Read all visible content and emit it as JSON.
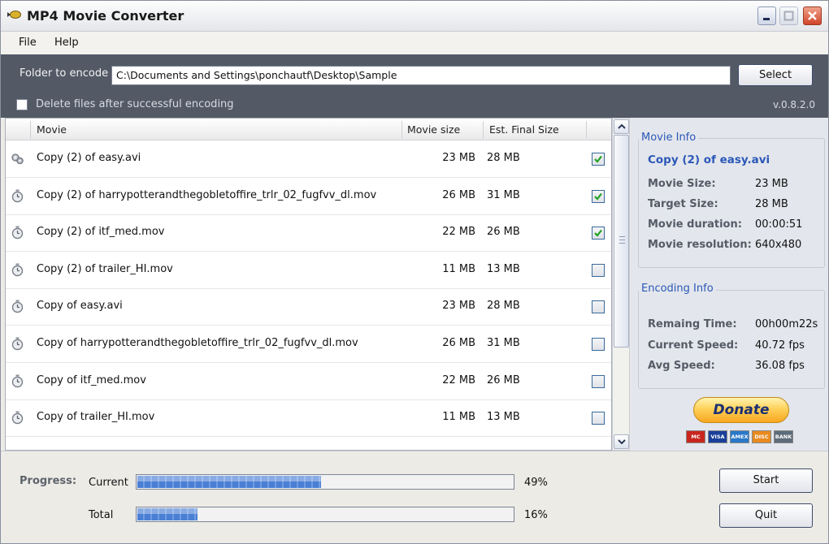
{
  "window": {
    "title": "MP4 Movie Converter"
  },
  "menu": [
    {
      "label": "File"
    },
    {
      "label": "Help"
    }
  ],
  "header": {
    "folder_label": "Folder to encode",
    "folder_path": "C:\\Documents and Settings\\ponchautf\\Desktop\\Sample",
    "select_label": "Select",
    "delete_label": "Delete files after successful encoding",
    "delete_checked": false,
    "version": "v.0.8.2.0"
  },
  "list": {
    "columns": [
      "Movie",
      "Movie size",
      "Est. Final Size"
    ],
    "rows": [
      {
        "name": "Copy (2) of easy.avi",
        "size": "23 MB",
        "est": "28 MB",
        "checked": true,
        "icon": "gears-icon"
      },
      {
        "name": "Copy (2) of harrypotterandthegobletoffire_trlr_02_fugfvv_dl.mov",
        "size": "26 MB",
        "est": "31 MB",
        "checked": true,
        "icon": "stopwatch-icon"
      },
      {
        "name": "Copy (2) of itf_med.mov",
        "size": "22 MB",
        "est": "26 MB",
        "checked": true,
        "icon": "stopwatch-icon"
      },
      {
        "name": "Copy (2) of trailer_HI.mov",
        "size": "11 MB",
        "est": "13 MB",
        "checked": false,
        "icon": "stopwatch-icon"
      },
      {
        "name": "Copy of easy.avi",
        "size": "23 MB",
        "est": "28 MB",
        "checked": false,
        "icon": "stopwatch-icon"
      },
      {
        "name": "Copy of harrypotterandthegobletoffire_trlr_02_fugfvv_dl.mov",
        "size": "26 MB",
        "est": "31 MB",
        "checked": false,
        "icon": "stopwatch-icon"
      },
      {
        "name": "Copy of itf_med.mov",
        "size": "22 MB",
        "est": "26 MB",
        "checked": false,
        "icon": "stopwatch-icon"
      },
      {
        "name": "Copy of trailer_HI.mov",
        "size": "11 MB",
        "est": "13 MB",
        "checked": false,
        "icon": "stopwatch-icon"
      }
    ]
  },
  "movie_info": {
    "title": "Movie Info",
    "selected": "Copy (2) of easy.avi",
    "fields": [
      {
        "label": "Movie Size:",
        "value": "23 MB"
      },
      {
        "label": "Target Size:",
        "value": "28 MB"
      },
      {
        "label": "Movie duration:",
        "value": "00:00:51"
      },
      {
        "label": "Movie resolution:",
        "value": "640x480"
      }
    ]
  },
  "encoding_info": {
    "title": "Encoding Info",
    "fields": [
      {
        "label": "Remaing Time:",
        "value": "00h00m22s"
      },
      {
        "label": "Current Speed:",
        "value": "40.72 fps"
      },
      {
        "label": "Avg Speed:",
        "value": "36.08 fps"
      }
    ]
  },
  "donate": {
    "label": "Donate",
    "cards": [
      "MC",
      "VISA",
      "AMEX",
      "DISC",
      "BANK"
    ]
  },
  "progress": {
    "label": "Progress:",
    "current_label": "Current",
    "current_value": 0.49,
    "current_text": "49%",
    "total_label": "Total",
    "total_value": 0.16,
    "total_text": "16%"
  },
  "buttons": {
    "start": "Start",
    "quit": "Quit"
  },
  "colors": {
    "header_bg": "#535a66",
    "accent_blue": "#2b58b8",
    "progress_blue": "#4b7fd4"
  }
}
